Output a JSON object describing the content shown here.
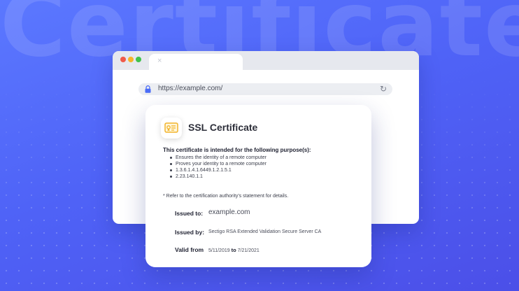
{
  "background_word": "Certificate",
  "browser": {
    "tab_close_symbol": "×",
    "address": "https://example.com/",
    "reload_symbol": "↻"
  },
  "certificate": {
    "title": "SSL Certificate",
    "purpose_heading": "This certificate is intended for the following purpose(s):",
    "purposes": [
      "Ensures the identity of a remote computer",
      "Proves your identity to a remote computer",
      "1.3.6.1.4.1.6449.1.2.1.5.1",
      "2.23.140.1.1"
    ],
    "note": "* Refer to the certification authority's statement for details.",
    "issued_to_label": "Issued to:",
    "issued_to": "example.com",
    "issued_by_label": "Issued by:",
    "issued_by": "Sectigo RSA Extended Validation Secure Server CA",
    "valid_from_label": "Valid from",
    "valid_from": "5/11/2019",
    "valid_to_word": "to",
    "valid_to": "7/21/2021"
  },
  "icons": {
    "lock": "lock-icon",
    "reload": "reload-icon",
    "certificate": "certificate-icon",
    "close": "close-icon"
  },
  "colors": {
    "background": "#5068f6",
    "accent_icon": "#f2b42b",
    "lock": "#4a6cf7",
    "traffic_red": "#f05a4a",
    "traffic_yellow": "#f6b42b",
    "traffic_green": "#3fc24b"
  }
}
